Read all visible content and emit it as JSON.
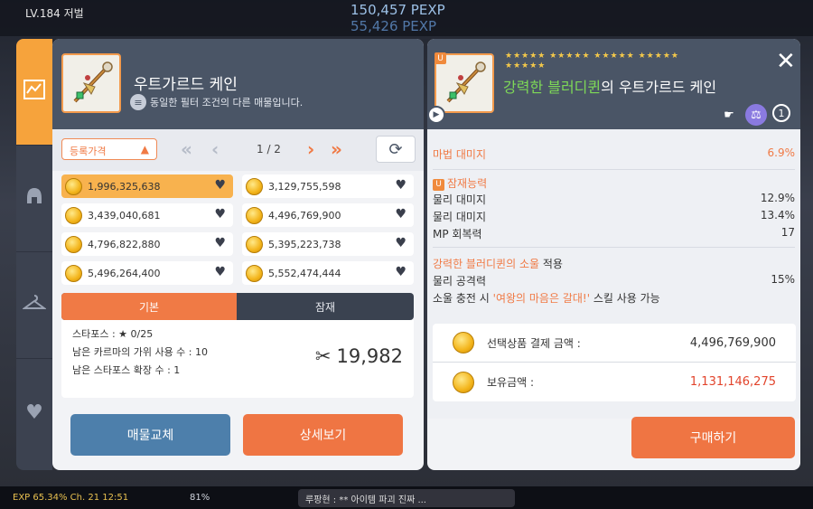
{
  "topbar": {
    "level": "LV.184 저벌",
    "exp_line1": "150,457 PEXP",
    "exp_line2": "55,426 PEXP"
  },
  "bottombar": {
    "exp_text": "EXP   65.34%   Ch. 21   12:51",
    "battery": "81%",
    "chat_text": "루팡현 : ** 아이템 파괴 진짜 ..."
  },
  "sidebar": {
    "tabs": [
      "chart-icon",
      "helmet-icon",
      "hanger-icon",
      "heart-icon"
    ]
  },
  "left": {
    "title": "우트가르드 케인",
    "subtitle": "동일한 필터 조건의 다른 매물입니다.",
    "sort_label": "등록가격",
    "page": "1 / 2",
    "prices": [
      "1,996,325,638",
      "3,129,755,598",
      "3,439,040,681",
      "4,496,769,900",
      "4,796,822,880",
      "5,395,223,738",
      "5,496,264,400",
      "5,552,474,444"
    ],
    "tab_basic": "기본",
    "tab_potential": "잠재",
    "starforce": "스타포스 : ★ 0/25",
    "scissors": "남은 카르마의 가위 사용 수 : 10",
    "star_ext": "남은 스타포스 확장 수 : 1",
    "scroll_count": "19,982",
    "btn_change": "매물교체",
    "btn_detail": "상세보기"
  },
  "right": {
    "stars": "★★★★★ ★★★★★ ★★★★★ ★★★★★ ★★★★★",
    "title_prefix": "강력한 블러디퀸",
    "title_suffix": "의 우트가르드 케인",
    "u_badge": "U",
    "magic_dmg_label": "마법 대미지",
    "magic_dmg_value": "6.9%",
    "potential_label": "잠재능력",
    "potentials": [
      {
        "label": "물리 대미지",
        "value": "12.9%"
      },
      {
        "label": "물리 대미지",
        "value": "13.4%"
      },
      {
        "label": "MP 회복력",
        "value": "17"
      }
    ],
    "soul_name": "강력한 블러디퀸의 소울",
    "soul_apply": " 적용",
    "soul_stat_label": "물리 공격력",
    "soul_stat_value": "15%",
    "soul_skill_prefix": "소울 충전 시 ",
    "soul_skill_name": "'여왕의 마음은 갈대!'",
    "soul_skill_suffix": " 스킬 사용 가능",
    "pay_label": "선택상품 결제 금액 :",
    "pay_amount": "4,496,769,900",
    "owned_label": "보유금액 :",
    "owned_amount": "1,131,146,275",
    "buy_button": "구매하기"
  },
  "colors": {
    "accent_orange": "#ef7543",
    "header_slate": "#4a5566",
    "blue_button": "#4d7fab",
    "highlight_gold": "#f8b24e",
    "green_title": "#7ed957",
    "red_amount": "#e2442c"
  }
}
